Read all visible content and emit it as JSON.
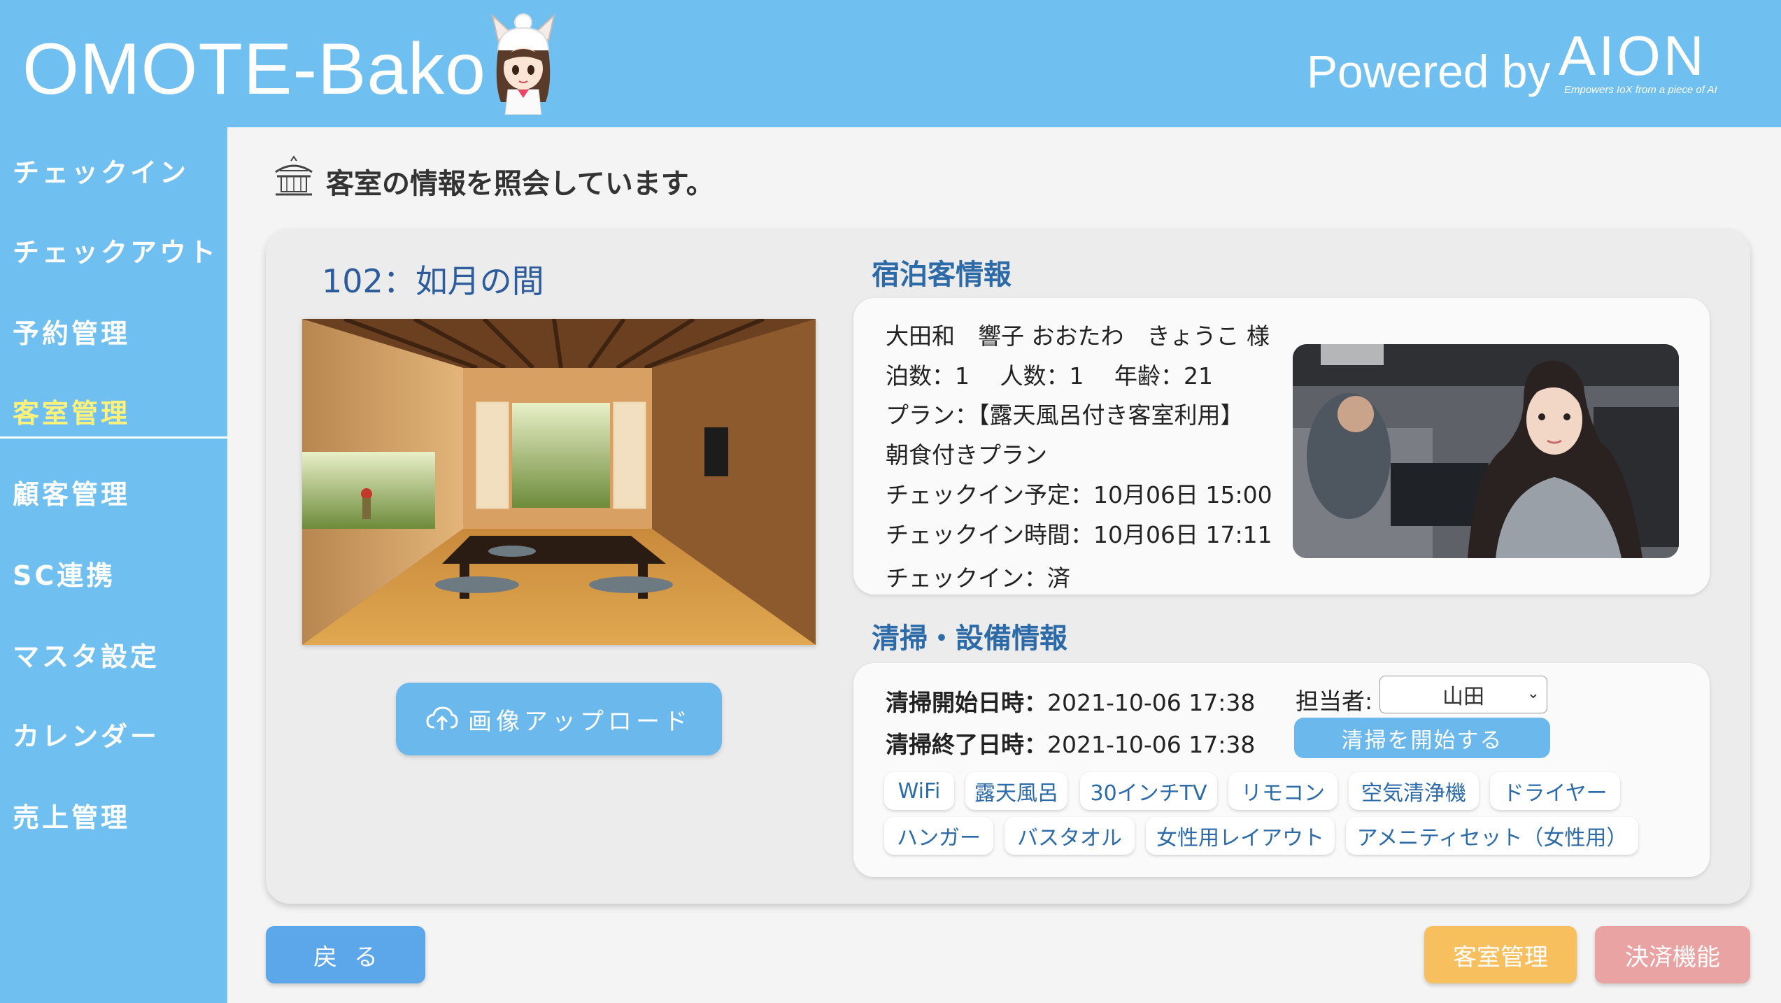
{
  "header": {
    "app_title": "OMOTE-Bako",
    "powered_by": "Powered by",
    "vendor_logo": "AION",
    "vendor_tagline": "Empowers IoX from a piece of AI",
    "mascot_icon": "mascot-girl-icon"
  },
  "sidebar": {
    "items": [
      {
        "label": "チェックイン"
      },
      {
        "label": "チェックアウト"
      },
      {
        "label": "予約管理"
      },
      {
        "label": "客室管理",
        "active": true
      },
      {
        "label": "顧客管理"
      },
      {
        "label": "SC連携"
      },
      {
        "label": "マスタ設定"
      },
      {
        "label": "カレンダー"
      },
      {
        "label": "売上管理"
      }
    ]
  },
  "page": {
    "title": "客室の情報を照会しています。",
    "title_icon": "japanese-inn-icon"
  },
  "room": {
    "name": "102：如月の間",
    "upload_label": "画像アップロード",
    "upload_icon": "cloud-upload-icon"
  },
  "guest": {
    "section_title": "宿泊客情報",
    "name_line": "大田和　響子 おおたわ　きょうこ 様",
    "stay_line": "泊数：1　 人数：1　 年齢：21",
    "plan_line1": "プラン：【露天風呂付き客室利用】",
    "plan_line2": "朝食付きプラン",
    "checkin_planned": "チェックイン予定：10月06日 15:00",
    "checkin_time": "チェックイン時間：10月06日 17:11",
    "checkin_status": "チェックイン：済"
  },
  "cleaning": {
    "section_title": "清掃・設備情報",
    "start_label": "清掃開始日時：",
    "start_value": "2021-10-06 17:38",
    "end_label": "清掃終了日時：",
    "end_value": "2021-10-06 17:38",
    "staff_label": "担当者:",
    "staff_value": "山田",
    "start_button": "清掃を開始する"
  },
  "amenities": [
    "WiFi",
    "露天風呂",
    "30インチTV",
    "リモコン",
    "空気清浄機",
    "ドライヤー",
    "ハンガー",
    "バスタオル",
    "女性用レイアウト",
    "アメニティセット（女性用）"
  ],
  "footer": {
    "back": "戻る",
    "room_management": "客室管理",
    "payment": "決済機能"
  },
  "colors": {
    "header_bg": "#6fbff0",
    "active_nav": "#fff27a",
    "section_title": "#2c6aa8",
    "primary_button": "#6bb8ec",
    "room_mgmt_button": "#f7bf5e",
    "payment_button": "#eaa3a3"
  }
}
